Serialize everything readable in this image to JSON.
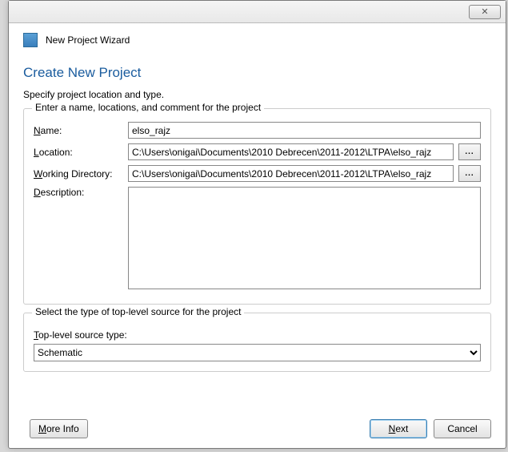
{
  "window": {
    "close_label": "✕",
    "wizard_title": "New Project Wizard"
  },
  "page": {
    "title": "Create New Project",
    "subtitle": "Specify project location and type."
  },
  "group1": {
    "legend": "Enter a name, locations, and comment for the project",
    "name_label": "Name:",
    "name_value": "elso_rajz",
    "location_label": "Location:",
    "location_value": "C:\\Users\\onigai\\Documents\\2010 Debrecen\\2011-2012\\LTPA\\elso_rajz",
    "workdir_label": "Working Directory:",
    "workdir_value": "C:\\Users\\onigai\\Documents\\2010 Debrecen\\2011-2012\\LTPA\\elso_rajz",
    "description_label": "Description:",
    "description_value": "",
    "browse_label": "..."
  },
  "group2": {
    "legend": "Select the type of top-level source for the project",
    "type_label": "Top-level source type:",
    "type_value": "Schematic"
  },
  "footer": {
    "more_info": "More Info",
    "next": "Next",
    "cancel": "Cancel"
  }
}
